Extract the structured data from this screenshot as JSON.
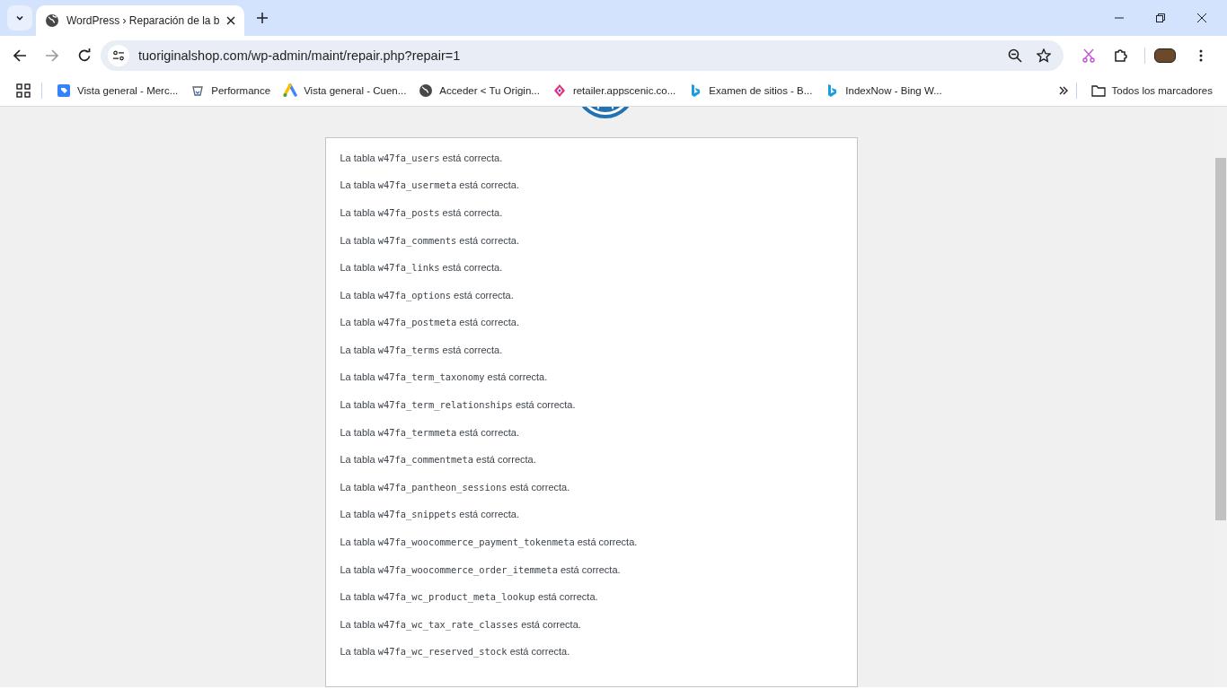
{
  "browser": {
    "tab": {
      "title": "WordPress › Reparación de la b",
      "selected": true
    },
    "address": "tuoriginalshop.com/wp-admin/maint/repair.php?repair=1",
    "bookmarks": [
      {
        "label": "Vista general - Merc...",
        "kind": "tag"
      },
      {
        "label": "Performance",
        "kind": "lab"
      },
      {
        "label": "Vista general - Cuen...",
        "kind": "ads"
      },
      {
        "label": "Acceder < Tu Origin...",
        "kind": "globe"
      },
      {
        "label": "retailer.appscenic.co...",
        "kind": "diamond"
      },
      {
        "label": "Examen de sitios - B...",
        "kind": "bing"
      },
      {
        "label": "IndexNow - Bing W...",
        "kind": "bing"
      }
    ],
    "all_bookmarks": "Todos los marcadores"
  },
  "results": [
    {
      "prefix": "La tabla",
      "table": "w47fa_users",
      "suffix": "está correcta."
    },
    {
      "prefix": "La tabla",
      "table": "w47fa_usermeta",
      "suffix": "está correcta."
    },
    {
      "prefix": "La tabla",
      "table": "w47fa_posts",
      "suffix": "está correcta."
    },
    {
      "prefix": "La tabla",
      "table": "w47fa_comments",
      "suffix": "está correcta."
    },
    {
      "prefix": "La tabla",
      "table": "w47fa_links",
      "suffix": "está correcta."
    },
    {
      "prefix": "La tabla",
      "table": "w47fa_options",
      "suffix": "está correcta."
    },
    {
      "prefix": "La tabla",
      "table": "w47fa_postmeta",
      "suffix": "está correcta."
    },
    {
      "prefix": "La tabla",
      "table": "w47fa_terms",
      "suffix": "está correcta."
    },
    {
      "prefix": "La tabla",
      "table": "w47fa_term_taxonomy",
      "suffix": "está correcta."
    },
    {
      "prefix": "La tabla",
      "table": "w47fa_term_relationships",
      "suffix": "está correcta."
    },
    {
      "prefix": "La tabla",
      "table": "w47fa_termmeta",
      "suffix": "está correcta."
    },
    {
      "prefix": "La tabla",
      "table": "w47fa_commentmeta",
      "suffix": "está correcta."
    },
    {
      "prefix": "La tabla",
      "table": "w47fa_pantheon_sessions",
      "suffix": "está correcta."
    },
    {
      "prefix": "La tabla",
      "table": "w47fa_snippets",
      "suffix": "está correcta."
    },
    {
      "prefix": "La tabla",
      "table": "w47fa_woocommerce_payment_tokenmeta",
      "suffix": "está correcta."
    },
    {
      "prefix": "La tabla",
      "table": "w47fa_woocommerce_order_itemmeta",
      "suffix": "está correcta."
    },
    {
      "prefix": "La tabla",
      "table": "w47fa_wc_product_meta_lookup",
      "suffix": "está correcta."
    },
    {
      "prefix": "La tabla",
      "table": "w47fa_wc_tax_rate_classes",
      "suffix": "está correcta."
    },
    {
      "prefix": "La tabla",
      "table": "w47fa_wc_reserved_stock",
      "suffix": "está correcta."
    }
  ]
}
